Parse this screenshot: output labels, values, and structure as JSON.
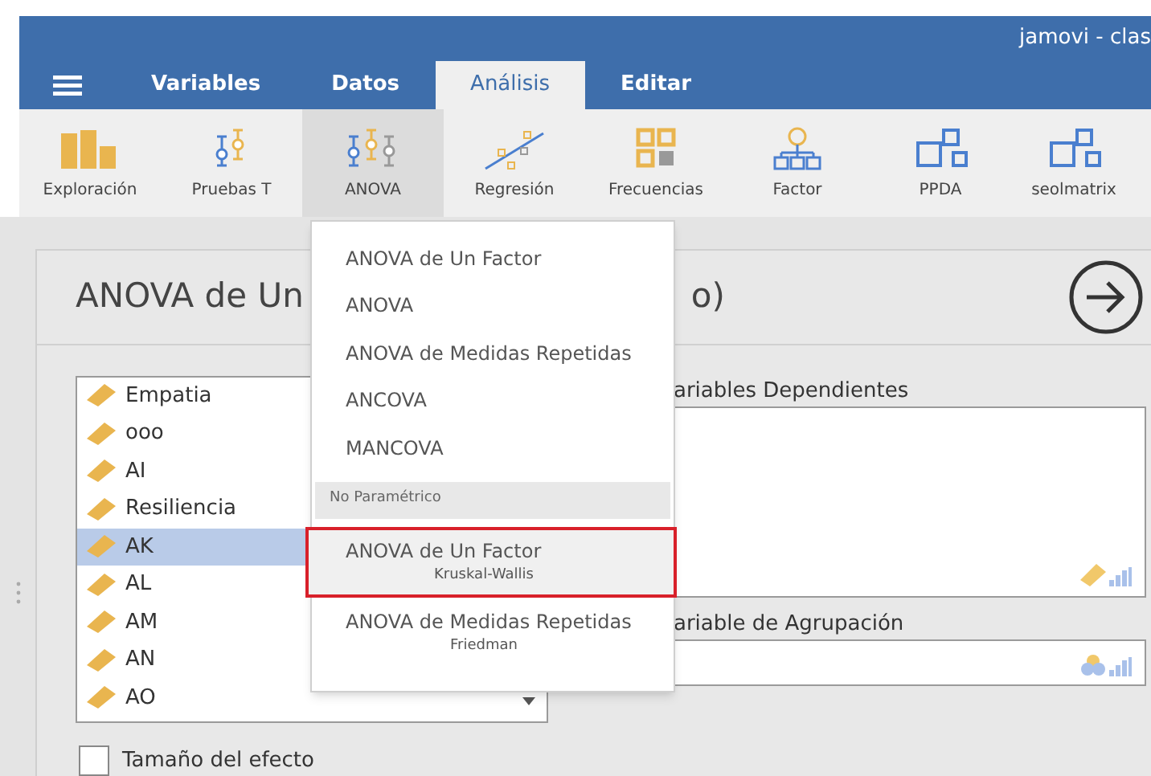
{
  "window": {
    "title": "jamovi - clas"
  },
  "tabs": [
    {
      "label": "Variables",
      "selected": false
    },
    {
      "label": "Datos",
      "selected": false
    },
    {
      "label": "Análisis",
      "selected": true
    },
    {
      "label": "Editar",
      "selected": false
    }
  ],
  "toolbar": [
    {
      "label": "Exploración",
      "kind": "bars",
      "selected": false
    },
    {
      "label": "Pruebas T",
      "kind": "ttest",
      "selected": false
    },
    {
      "label": "ANOVA",
      "kind": "anova",
      "selected": true
    },
    {
      "label": "Regresión",
      "kind": "regression",
      "selected": false
    },
    {
      "label": "Frecuencias",
      "kind": "grid",
      "selected": false
    },
    {
      "label": "Factor",
      "kind": "tree",
      "selected": false
    },
    {
      "label": "PPDA",
      "kind": "module",
      "selected": false
    },
    {
      "label": "seolmatrix",
      "kind": "module",
      "selected": false
    }
  ],
  "analysis": {
    "title_start": "ANOVA de Un",
    "title_end": "o)",
    "variables": [
      {
        "name": "Empatia",
        "selected": false
      },
      {
        "name": "ooo",
        "selected": false
      },
      {
        "name": "AI",
        "selected": false
      },
      {
        "name": "Resiliencia",
        "selected": false
      },
      {
        "name": "AK",
        "selected": true
      },
      {
        "name": "AL",
        "selected": false
      },
      {
        "name": "AM",
        "selected": false
      },
      {
        "name": "AN",
        "selected": false
      },
      {
        "name": "AO",
        "selected": false
      }
    ],
    "dependent_label": "ariables Dependientes",
    "grouping_label": "ariable de Agrupación",
    "effect_size": {
      "label": "Tamaño del efecto",
      "checked": false
    }
  },
  "menu": {
    "items": [
      {
        "kind": "item",
        "label": "ANOVA de Un Factor",
        "highlighted": false
      },
      {
        "kind": "item",
        "label": "ANOVA",
        "highlighted": false
      },
      {
        "kind": "item",
        "label": "ANOVA de Medidas Repetidas",
        "highlighted": false
      },
      {
        "kind": "item",
        "label": "ANCOVA",
        "highlighted": false
      },
      {
        "kind": "item",
        "label": "MANCOVA",
        "highlighted": false
      },
      {
        "kind": "header",
        "label": "No Paramétrico"
      },
      {
        "kind": "item",
        "label": "ANOVA de Un Factor",
        "subtitle": "Kruskal-Wallis",
        "highlighted": true
      },
      {
        "kind": "item",
        "label": "ANOVA de Medidas Repetidas",
        "subtitle": "Friedman",
        "highlighted": false
      }
    ]
  }
}
